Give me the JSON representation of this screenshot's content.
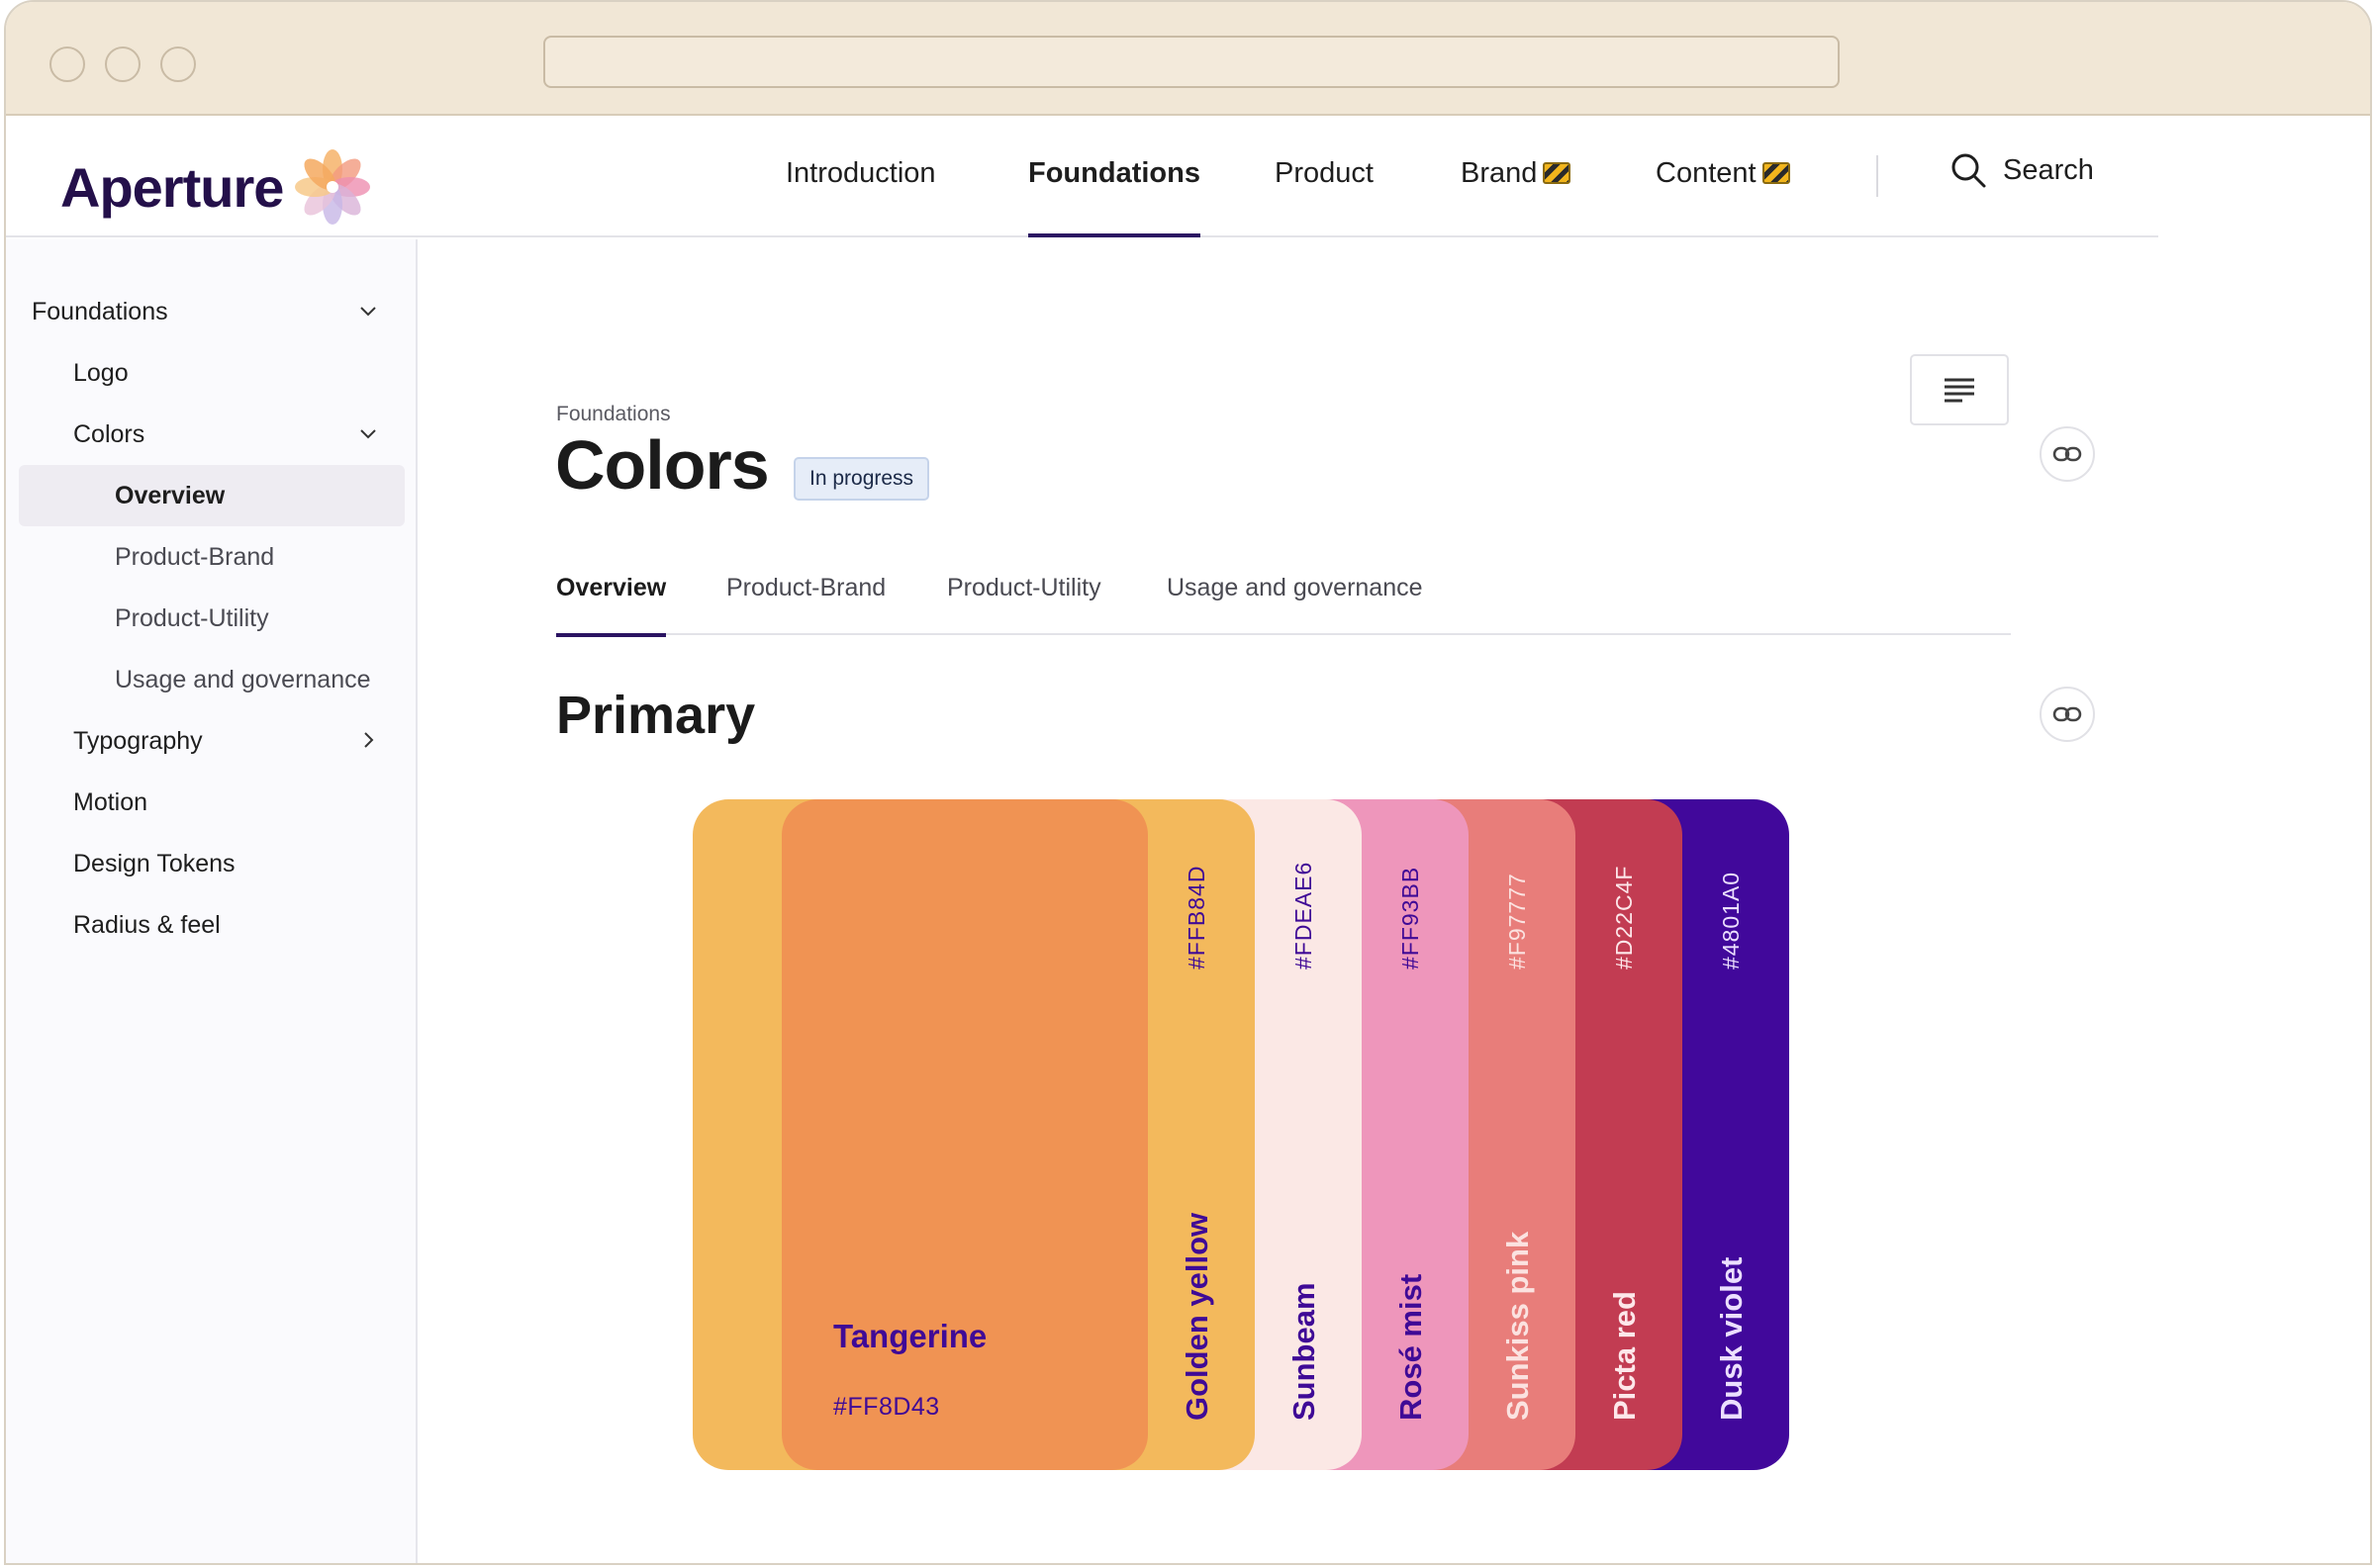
{
  "brand": {
    "name": "Aperture"
  },
  "nav": {
    "items": [
      {
        "label": "Introduction"
      },
      {
        "label": "Foundations"
      },
      {
        "label": "Product"
      },
      {
        "label": "Brand"
      },
      {
        "label": "Content"
      }
    ],
    "active": "Foundations",
    "search_label": "Search"
  },
  "sidebar": {
    "items": [
      {
        "label": "Foundations",
        "level": 0,
        "chevron": "down"
      },
      {
        "label": "Logo",
        "level": 1
      },
      {
        "label": "Colors",
        "level": 1,
        "chevron": "down"
      },
      {
        "label": "Overview",
        "level": 2,
        "selected": true
      },
      {
        "label": "Product-Brand",
        "level": 2
      },
      {
        "label": "Product-Utility",
        "level": 2
      },
      {
        "label": "Usage and governance",
        "level": 2
      },
      {
        "label": "Typography",
        "level": 1,
        "chevron": "right"
      },
      {
        "label": "Motion",
        "level": 1
      },
      {
        "label": "Design Tokens",
        "level": 1
      },
      {
        "label": "Radius & feel",
        "level": 1
      }
    ]
  },
  "page": {
    "breadcrumb": "Foundations",
    "title": "Colors",
    "status": "In progress"
  },
  "tabs": [
    {
      "label": "Overview",
      "active": true
    },
    {
      "label": "Product-Brand"
    },
    {
      "label": "Product-Utility"
    },
    {
      "label": "Usage and governance"
    }
  ],
  "section": {
    "title": "Primary"
  },
  "palette": [
    {
      "name": "Tangerine",
      "hex": "#FF8D43",
      "fill": "#f09353",
      "text": "#3f0a96"
    },
    {
      "name": "Golden yellow",
      "hex": "#FFB84D",
      "fill": "#f3b95c",
      "text": "#3f0a96"
    },
    {
      "name": "Sunbeam",
      "hex": "#FDEAE6",
      "fill": "#fbe8e5",
      "text": "#3f0a96"
    },
    {
      "name": "Rosé mist",
      "hex": "#FF93BB",
      "fill": "#ee96bb",
      "text": "#3f0a96"
    },
    {
      "name": "Sunkiss pink",
      "hex": "#F97777",
      "fill": "#e87d7a",
      "text": "#fbe2e0"
    },
    {
      "name": "Picta red",
      "hex": "#D22C4F",
      "fill": "#c23c52",
      "text": "#fde7ea"
    },
    {
      "name": "Dusk violet",
      "hex": "#4801A0",
      "fill": "#41089b",
      "text": "#ecdfff"
    }
  ]
}
